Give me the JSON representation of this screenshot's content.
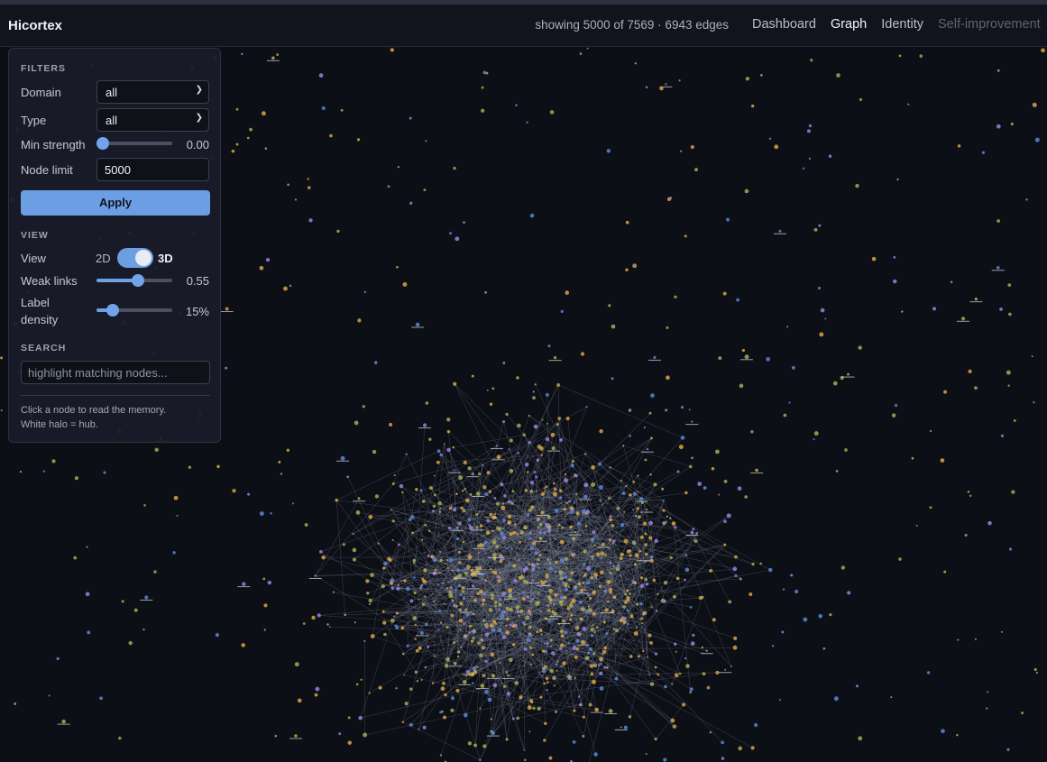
{
  "header": {
    "brand": "Hicortex",
    "stats": "showing 5000 of 7569 · 6943 edges",
    "nav": [
      "Dashboard",
      "Graph",
      "Identity",
      "Self-improvement"
    ],
    "active_nav": "Graph"
  },
  "filters": {
    "title": "FILTERS",
    "domain_label": "Domain",
    "domain_value": "all",
    "type_label": "Type",
    "type_value": "all",
    "min_strength_label": "Min strength",
    "min_strength_value": "0.00",
    "min_strength_fraction": 0,
    "node_limit_label": "Node limit",
    "node_limit_value": "5000",
    "apply_label": "Apply"
  },
  "view": {
    "title": "VIEW",
    "view_label": "View",
    "option_2d": "2D",
    "option_3d": "3D",
    "selected": "3D",
    "weak_links_label": "Weak links",
    "weak_links_value": "0.55",
    "weak_links_fraction": 0.55,
    "label_density_label_line1": "Label",
    "label_density_label_line2": "density",
    "label_density_value": "15%",
    "label_density_fraction": 0.15
  },
  "search": {
    "title": "SEARCH",
    "placeholder": "highlight matching nodes..."
  },
  "help": {
    "line1": "Click a node to read the memory.",
    "line2": "White halo = hub."
  },
  "graph_colors": {
    "background": "#0d0f16",
    "edge": "#7c8497",
    "node_gold": "#d8a444",
    "node_olive": "#a9a756",
    "node_purple": "#9b80e0",
    "node_blue": "#5b86d6",
    "hub_halo": "#ffffff"
  },
  "icons": {
    "dropdown": "chevron-down-icon"
  }
}
